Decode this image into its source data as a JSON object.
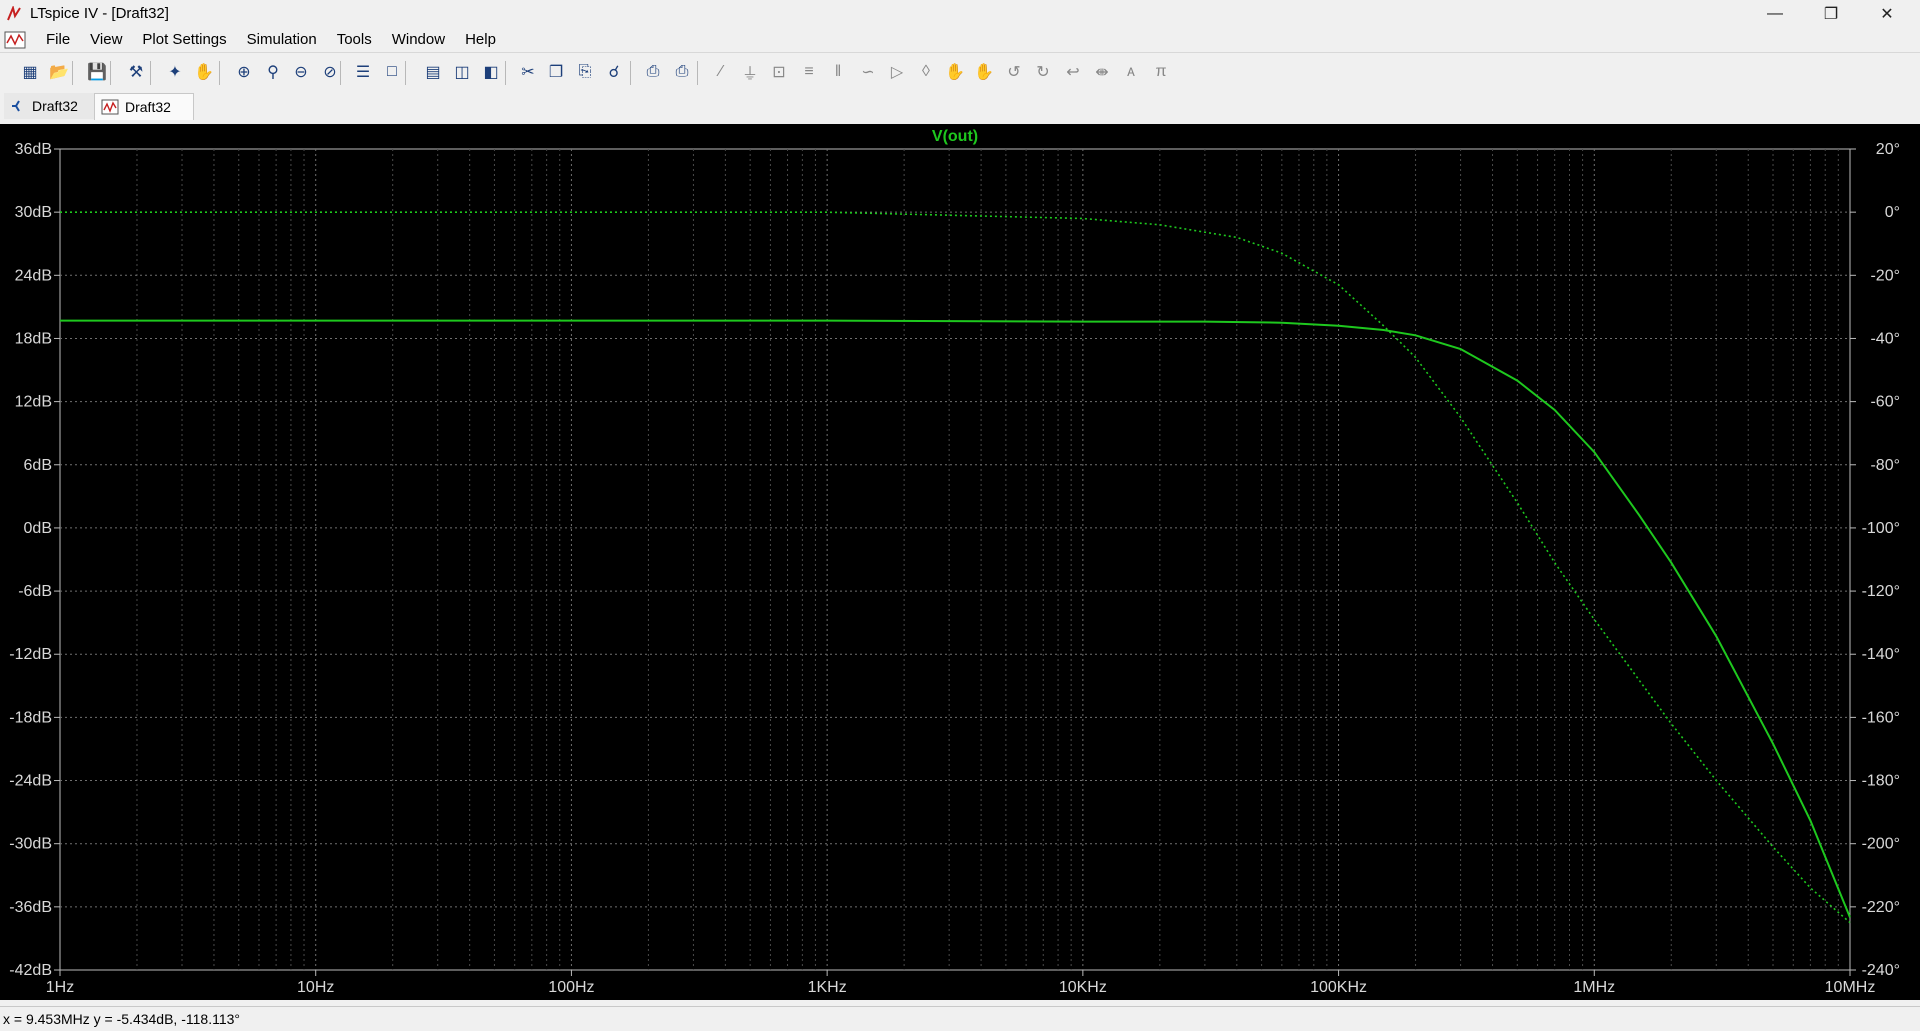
{
  "window": {
    "title": "LTspice IV - [Draft32]"
  },
  "menu": {
    "items": [
      "File",
      "View",
      "Plot Settings",
      "Simulation",
      "Tools",
      "Window",
      "Help"
    ]
  },
  "tabs": [
    {
      "label": "Draft32",
      "icon": "schematic-icon"
    },
    {
      "label": "Draft32",
      "icon": "waveform-icon"
    }
  ],
  "toolbar_icons": [
    "new-schematic-icon",
    "open-icon",
    "save-icon",
    "control-panel-icon",
    "run-icon",
    "halt-icon",
    "zoom-in-icon",
    "zoom-area-icon",
    "zoom-out-icon",
    "zoom-fit-icon",
    "autorange-icon",
    "mark-icon",
    "tile-horizontal-icon",
    "cascade-icon",
    "tile-vertical-icon",
    "cut-icon",
    "copy-icon",
    "paste-icon",
    "find-icon",
    "print-setup-icon",
    "print-icon",
    "wire-icon",
    "ground-icon",
    "label-icon",
    "resistor-icon",
    "capacitor-icon",
    "inductor-icon",
    "diode-icon",
    "component-icon",
    "move-icon",
    "drag-icon",
    "undo-icon",
    "redo-icon",
    "rotate-icon",
    "mirror-icon",
    "text-icon",
    "spice-directive-icon"
  ],
  "status": {
    "text": "x = 9.453MHz    y = -5.434dB, -118.113°"
  },
  "colors": {
    "plot_bg": "#000000",
    "trace": "#1ec81e",
    "grid": "#4a4a4a",
    "axis_text": "#d8d8d8",
    "title": "#1ec81e"
  },
  "chart_data": {
    "type": "line",
    "title": "V(out)",
    "xscale": "log",
    "xlim": [
      1,
      10000000
    ],
    "x_ticks": [
      1,
      10,
      100,
      1000,
      10000,
      100000,
      1000000,
      10000000
    ],
    "x_tick_labels": [
      "1Hz",
      "10Hz",
      "100Hz",
      "1KHz",
      "10KHz",
      "100KHz",
      "1MHz",
      "10MHz"
    ],
    "ylim_left": [
      -42,
      36
    ],
    "y_left_ticks": [
      36,
      30,
      24,
      18,
      12,
      6,
      0,
      -6,
      -12,
      -18,
      -24,
      -30,
      -36,
      -42
    ],
    "y_left_tick_labels": [
      "36dB",
      "30dB",
      "24dB",
      "18dB",
      "12dB",
      "6dB",
      "0dB",
      "-6dB",
      "-12dB",
      "-18dB",
      "-24dB",
      "-30dB",
      "-36dB",
      "-42dB"
    ],
    "ylim_right": [
      -240,
      20
    ],
    "y_right_ticks": [
      20,
      0,
      -20,
      -40,
      -60,
      -80,
      -100,
      -120,
      -140,
      -160,
      -180,
      -200,
      -220,
      -240
    ],
    "y_right_tick_labels": [
      "20°",
      "0°",
      "-20°",
      "-40°",
      "-60°",
      "-80°",
      "-100°",
      "-120°",
      "-140°",
      "-160°",
      "-180°",
      "-200°",
      "-220°",
      "-240°"
    ],
    "grid": true,
    "series": [
      {
        "axis": "left",
        "style": "solid",
        "x": [
          1,
          10,
          100,
          1000,
          10000,
          30000,
          60000,
          100000,
          150000,
          200000,
          300000,
          500000,
          700000,
          1000000,
          1500000,
          2000000,
          3000000,
          5000000,
          7000000,
          10000000
        ],
        "y": [
          19.7,
          19.7,
          19.7,
          19.7,
          19.6,
          19.6,
          19.5,
          19.2,
          18.8,
          18.3,
          17.0,
          14.0,
          11.2,
          7.2,
          1.2,
          -3.3,
          -10.3,
          -20.5,
          -27.8,
          -37.0
        ]
      },
      {
        "axis": "right",
        "style": "dotted",
        "x": [
          1,
          10,
          100,
          1000,
          10000,
          20000,
          40000,
          60000,
          100000,
          150000,
          200000,
          300000,
          500000,
          700000,
          1000000,
          2000000,
          3000000,
          5000000,
          7000000,
          10000000
        ],
        "y": [
          0,
          0,
          0,
          0,
          -2,
          -4,
          -8,
          -13,
          -23,
          -36,
          -46,
          -65,
          -92,
          -111,
          -129,
          -162,
          -180,
          -201,
          -214,
          -225
        ]
      }
    ]
  }
}
